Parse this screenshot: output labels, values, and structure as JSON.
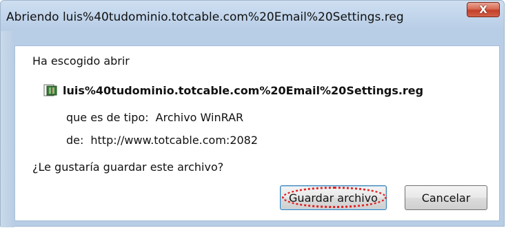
{
  "window": {
    "title": "Abriendo luis%40tudominio.totcable.com%20Email%20Settings.reg",
    "close_glyph": "X"
  },
  "dialog": {
    "intro": "Ha escogido abrir",
    "file_icon": "winrar-file-icon",
    "file_name": "luis%40tudominio.totcable.com%20Email%20Settings.reg",
    "type_label": "que es de tipo:",
    "type_value": "Archivo WinRAR",
    "from_label": "de:",
    "from_value": "http://www.totcable.com:2082",
    "question": "¿Le gustaría guardar este archivo?"
  },
  "buttons": {
    "save_label": "Guardar archivo",
    "cancel_label": "Cancelar"
  },
  "colors": {
    "annotation": "#e02020",
    "titlebar": "#c3d6ec"
  }
}
